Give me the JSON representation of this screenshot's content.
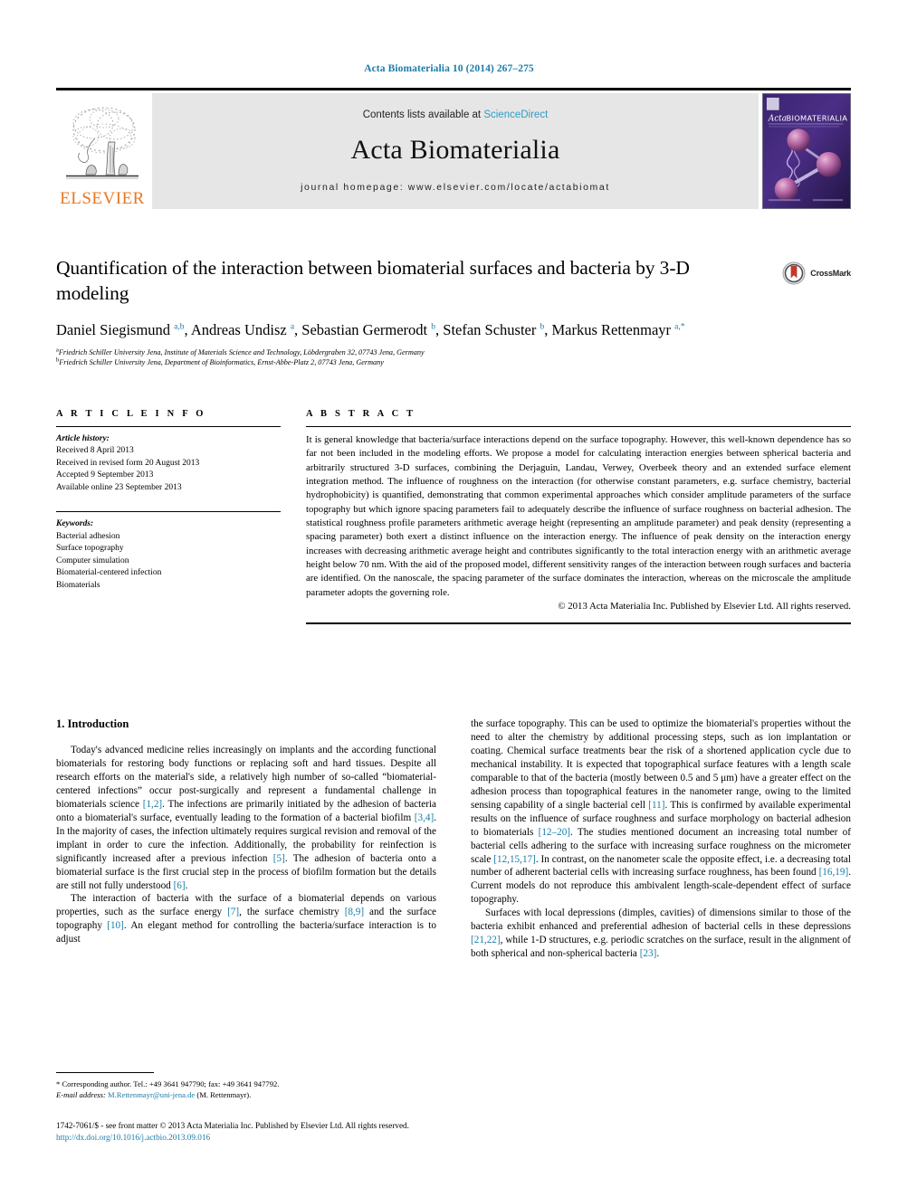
{
  "running_head": "Acta Biomaterialia 10 (2014) 267–275",
  "masthead": {
    "publisher_name": "ELSEVIER",
    "contents_prefix": "Contents lists available at ",
    "contents_link": "ScienceDirect",
    "journal_name": "Acta Biomaterialia",
    "homepage": "journal homepage: www.elsevier.com/locate/actabiomat",
    "cover_title_italic": "Acta",
    "cover_title_rest": "BIOMATERIALIA"
  },
  "article": {
    "title": "Quantification of the interaction between biomaterial surfaces and bacteria by 3-D modeling",
    "crossmark_label": "CrossMark",
    "authors_html": "Daniel Siegismund <sup>a,b</sup>, Andreas Undisz <sup>a</sup>, Sebastian Germerodt <sup>b</sup>, Stefan Schuster <sup>b</sup>, Markus Rettenmayr <sup>a,*</sup>",
    "affiliations": [
      {
        "marker": "a",
        "text": "Friedrich Schiller University Jena, Institute of Materials Science and Technology, Löbdergraben 32, 07743 Jena, Germany"
      },
      {
        "marker": "b",
        "text": "Friedrich Schiller University Jena, Department of Bioinformatics, Ernst-Abbe-Platz 2, 07743 Jena, Germany"
      }
    ]
  },
  "article_info": {
    "heading": "A R T I C L E   I N F O",
    "history_label": "Article history:",
    "history": [
      "Received 8 April 2013",
      "Received in revised form 20 August 2013",
      "Accepted 9 September 2013",
      "Available online 23 September 2013"
    ],
    "keywords_label": "Keywords:",
    "keywords": [
      "Bacterial adhesion",
      "Surface topography",
      "Computer simulation",
      "Biomaterial-centered infection",
      "Biomaterials"
    ]
  },
  "abstract": {
    "heading": "A B S T R A C T",
    "text": "It is general knowledge that bacteria/surface interactions depend on the surface topography. However, this well-known dependence has so far not been included in the modeling efforts. We propose a model for calculating interaction energies between spherical bacteria and arbitrarily structured 3-D surfaces, combining the Derjaguin, Landau, Verwey, Overbeek theory and an extended surface element integration method. The influence of roughness on the interaction (for otherwise constant parameters, e.g. surface chemistry, bacterial hydrophobicity) is quantified, demonstrating that common experimental approaches which consider amplitude parameters of the surface topography but which ignore spacing parameters fail to adequately describe the influence of surface roughness on bacterial adhesion. The statistical roughness profile parameters arithmetic average height (representing an amplitude parameter) and peak density (representing a spacing parameter) both exert a distinct influence on the interaction energy. The influence of peak density on the interaction energy increases with decreasing arithmetic average height and contributes significantly to the total interaction energy with an arithmetic average height below 70 nm. With the aid of the proposed model, different sensitivity ranges of the interaction between rough surfaces and bacteria are identified. On the nanoscale, the spacing parameter of the surface dominates the interaction, whereas on the microscale the amplitude parameter adopts the governing role.",
    "copyright": "© 2013 Acta Materialia Inc. Published by Elsevier Ltd. All rights reserved."
  },
  "sections": {
    "intro_heading": "1. Introduction",
    "left_paragraphs": [
      "Today's advanced medicine relies increasingly on implants and the according functional biomaterials for restoring body functions or replacing soft and hard tissues. Despite all research efforts on the material's side, a relatively high number of so-called “biomaterial-centered infections” occur post-surgically and represent a fundamental challenge in biomaterials science [1,2]. The infections are primarily initiated by the adhesion of bacteria onto a biomaterial's surface, eventually leading to the formation of a bacterial biofilm [3,4]. In the majority of cases, the infection ultimately requires surgical revision and removal of the implant in order to cure the infection. Additionally, the probability for reinfection is significantly increased after a previous infection [5]. The adhesion of bacteria onto a biomaterial surface is the first crucial step in the process of biofilm formation but the details are still not fully understood [6].",
      "The interaction of bacteria with the surface of a biomaterial depends on various properties, such as the surface energy [7], the surface chemistry [8,9] and the surface topography [10]. An elegant method for controlling the bacteria/surface interaction is to adjust"
    ],
    "right_paragraphs": [
      "the surface topography. This can be used to optimize the biomaterial's properties without the need to alter the chemistry by additional processing steps, such as ion implantation or coating. Chemical surface treatments bear the risk of a shortened application cycle due to mechanical instability. It is expected that topographical surface features with a length scale comparable to that of the bacteria (mostly between 0.5 and 5 μm) have a greater effect on the adhesion process than topographical features in the nanometer range, owing to the limited sensing capability of a single bacterial cell [11]. This is confirmed by available experimental results on the influence of surface roughness and surface morphology on bacterial adhesion to biomaterials [12–20]. The studies mentioned document an increasing total number of bacterial cells adhering to the surface with increasing surface roughness on the micrometer scale [12,15,17]. In contrast, on the nanometer scale the opposite effect, i.e. a decreasing total number of adherent bacterial cells with increasing surface roughness, has been found [16,19]. Current models do not reproduce this ambivalent length-scale-dependent effect of surface topography.",
      "Surfaces with local depressions (dimples, cavities) of dimensions similar to those of the bacteria exhibit enhanced and preferential adhesion of bacterial cells in these depressions [21,22], while 1-D structures, e.g. periodic scratches on the surface, result in the alignment of both spherical and non-spherical bacteria [23]."
    ]
  },
  "footnote": {
    "star": "*",
    "corresponding": "Corresponding author. Tel.: +49 3641 947790; fax: +49 3641 947792.",
    "email_label": "E-mail address:",
    "email": "M.Rettenmayr@uni-jena.de",
    "email_suffix": "(M. Rettenmayr)."
  },
  "footer": {
    "line1": "1742-7061/$ - see front matter © 2013 Acta Materialia Inc. Published by Elsevier Ltd. All rights reserved.",
    "doi": "http://dx.doi.org/10.1016/j.actbio.2013.09.016"
  },
  "colors": {
    "link": "#1a7ca8",
    "sciencedirect": "#2e9bc9",
    "elsevier_orange": "#e87722",
    "band_gray": "#e6e6e6"
  }
}
